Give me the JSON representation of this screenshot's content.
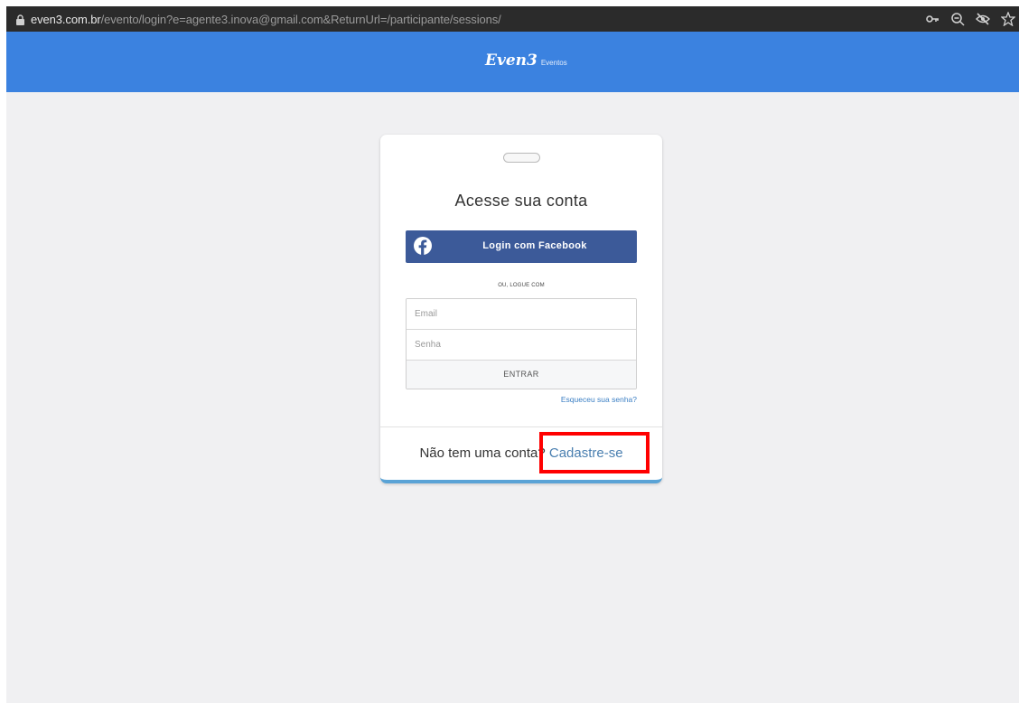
{
  "browser": {
    "url_domain": "even3.com.br",
    "url_path": "/evento/login?e=agente3.inova@gmail.com&ReturnUrl=/participante/sessions/",
    "icons": [
      "lock-icon",
      "key-icon",
      "zoom-out-icon",
      "eye-off-icon",
      "star-icon"
    ]
  },
  "header": {
    "logo_text": "Even3",
    "logo_subtext": "Eventos",
    "background": "#3b82e0"
  },
  "login": {
    "title": "Acesse sua conta",
    "facebook_button": "Login com Facebook",
    "or_text": "OU, LOGUE COM",
    "email_placeholder": "Email",
    "password_placeholder": "Senha",
    "submit_button": "ENTRAR",
    "forgot_password": "Esqueceu sua senha?",
    "no_account_text": "Não tem uma conta?",
    "signup_link": "Cadastre-se"
  },
  "colors": {
    "facebook_blue": "#3c5a99",
    "link_blue": "#3b7fc4",
    "highlight_red": "#ff0000"
  }
}
